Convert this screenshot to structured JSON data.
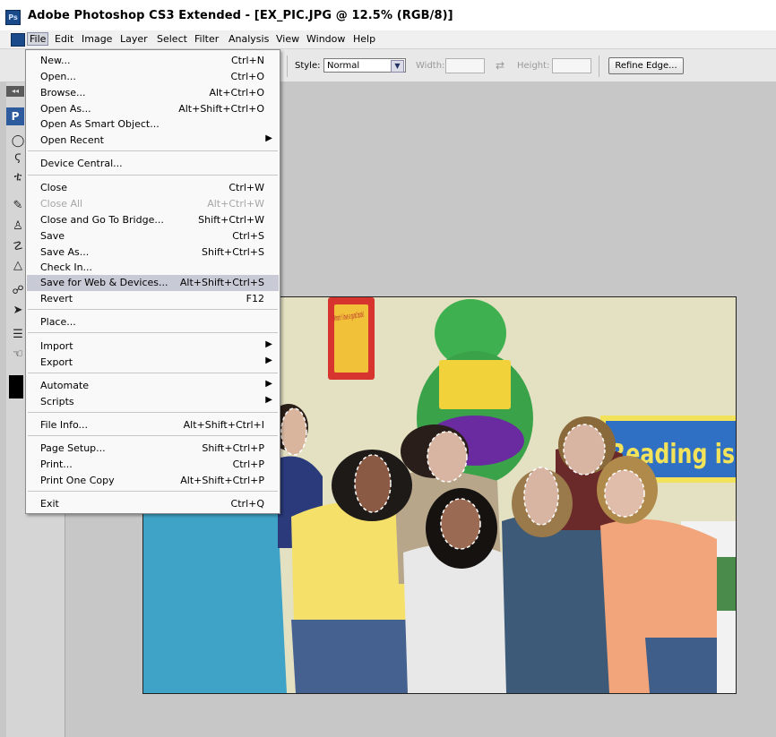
{
  "window": {
    "title": "Adobe Photoshop CS3 Extended - [EX_PIC.JPG @ 12.5% (RGB/8)]",
    "logo_text": "Ps"
  },
  "menubar": {
    "items": [
      "File",
      "Edit",
      "Image",
      "Layer",
      "Select",
      "Filter",
      "Analysis",
      "View",
      "Window",
      "Help"
    ],
    "active": "File"
  },
  "options_bar": {
    "style_label": "Style:",
    "style_value": "Normal",
    "width_label": "Width:",
    "height_label": "Height:",
    "refine_edge": "Refine Edge...",
    "swap_icon": "⇄"
  },
  "toolbox": {
    "collapse": "◂◂",
    "badge": "P"
  },
  "file_menu": {
    "items": [
      {
        "label": "New...",
        "shortcut": "Ctrl+N"
      },
      {
        "label": "Open...",
        "shortcut": "Ctrl+O"
      },
      {
        "label": "Browse...",
        "shortcut": "Alt+Ctrl+O"
      },
      {
        "label": "Open As...",
        "shortcut": "Alt+Shift+Ctrl+O"
      },
      {
        "label": "Open As Smart Object...",
        "shortcut": ""
      },
      {
        "label": "Open Recent",
        "shortcut": "",
        "submenu": true
      },
      {
        "label": "Device Central...",
        "shortcut": ""
      },
      {
        "label": "Close",
        "shortcut": "Ctrl+W"
      },
      {
        "label": "Close All",
        "shortcut": "Alt+Ctrl+W",
        "disabled": true
      },
      {
        "label": "Close and Go To Bridge...",
        "shortcut": "Shift+Ctrl+W"
      },
      {
        "label": "Save",
        "shortcut": "Ctrl+S"
      },
      {
        "label": "Save As...",
        "shortcut": "Shift+Ctrl+S"
      },
      {
        "label": "Check In...",
        "shortcut": ""
      },
      {
        "label": "Save for Web & Devices...",
        "shortcut": "Alt+Shift+Ctrl+S",
        "highlighted": true
      },
      {
        "label": "Revert",
        "shortcut": "F12"
      },
      {
        "label": "Place...",
        "shortcut": ""
      },
      {
        "label": "Import",
        "shortcut": "",
        "submenu": true
      },
      {
        "label": "Export",
        "shortcut": "",
        "submenu": true
      },
      {
        "label": "Automate",
        "shortcut": "",
        "submenu": true
      },
      {
        "label": "Scripts",
        "shortcut": "",
        "submenu": true
      },
      {
        "label": "File Info...",
        "shortcut": "Alt+Shift+Ctrl+I"
      },
      {
        "label": "Page Setup...",
        "shortcut": "Shift+Ctrl+P"
      },
      {
        "label": "Print...",
        "shortcut": "Ctrl+P"
      },
      {
        "label": "Print One Copy",
        "shortcut": "Alt+Shift+Ctrl+P"
      },
      {
        "label": "Exit",
        "shortcut": "Ctrl+Q"
      }
    ],
    "submenu_arrow": "▶"
  },
  "photo": {
    "poster_text": "Mmm! I love a good book!",
    "banner_text": "Reading is"
  },
  "colors": {
    "workspace": "#c7c7c7",
    "menu_highlight": "#c8cad6",
    "banner_blue": "#2f6fc4",
    "banner_yellow": "#f2e35a"
  }
}
